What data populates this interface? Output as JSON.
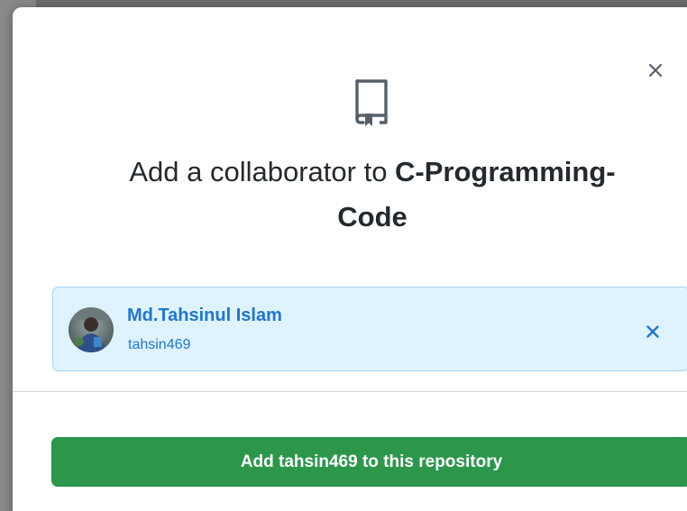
{
  "modal": {
    "title_prefix": "Add a collaborator to ",
    "repo_name": "C-Programming-\nCode",
    "close_icon": "close-icon",
    "repo_icon": "repo-icon"
  },
  "selected_user": {
    "display_name": "Md.Tahsinul Islam",
    "login": "tahsin469",
    "remove_icon": "close-icon"
  },
  "action": {
    "button_label": "Add tahsin469 to this repository"
  },
  "colors": {
    "primary_button": "#2c974b",
    "user_card_bg": "#dff3ff",
    "user_card_border": "#9fd6f3",
    "link_blue": "#1f76d2"
  }
}
